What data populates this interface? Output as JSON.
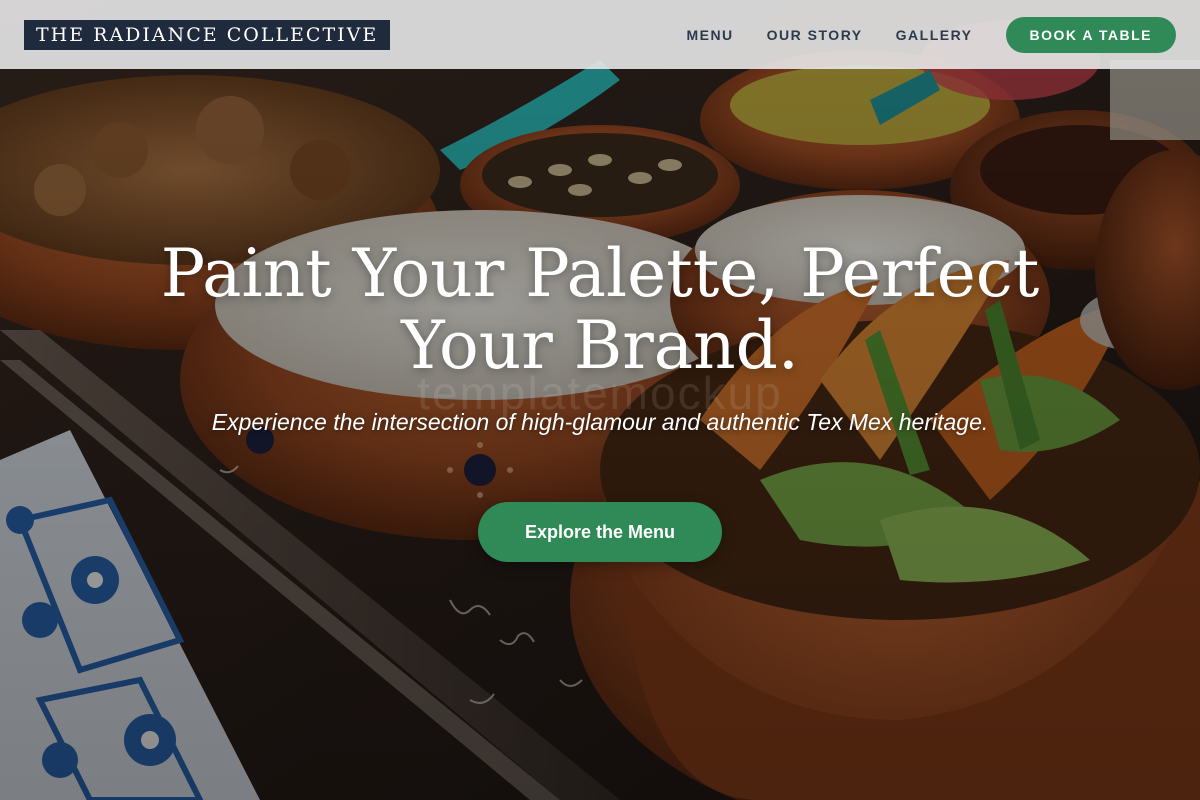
{
  "brand": {
    "logo_text": "THE RADIANCE COLLECTIVE"
  },
  "nav": {
    "items": [
      {
        "label": "MENU"
      },
      {
        "label": "OUR STORY"
      },
      {
        "label": "GALLERY"
      }
    ],
    "cta_label": "BOOK A TABLE"
  },
  "hero": {
    "headline_line1": "Paint Your Palette, Perfect",
    "headline_line2": "Your Brand.",
    "subheadline": "Experience the intersection of high-glamour and authentic Tex Mex heritage.",
    "cta_label": "Explore the Menu",
    "background_image": "Clay bowls of Mexican dishes on a table with blue Talavera tiles",
    "watermark_text": "templatemockup"
  },
  "colors": {
    "accent_green": "#2f8a57",
    "logo_bg": "#1f2a3c",
    "header_bg": "#e8e8e8",
    "nav_text": "#2c3a4d"
  }
}
